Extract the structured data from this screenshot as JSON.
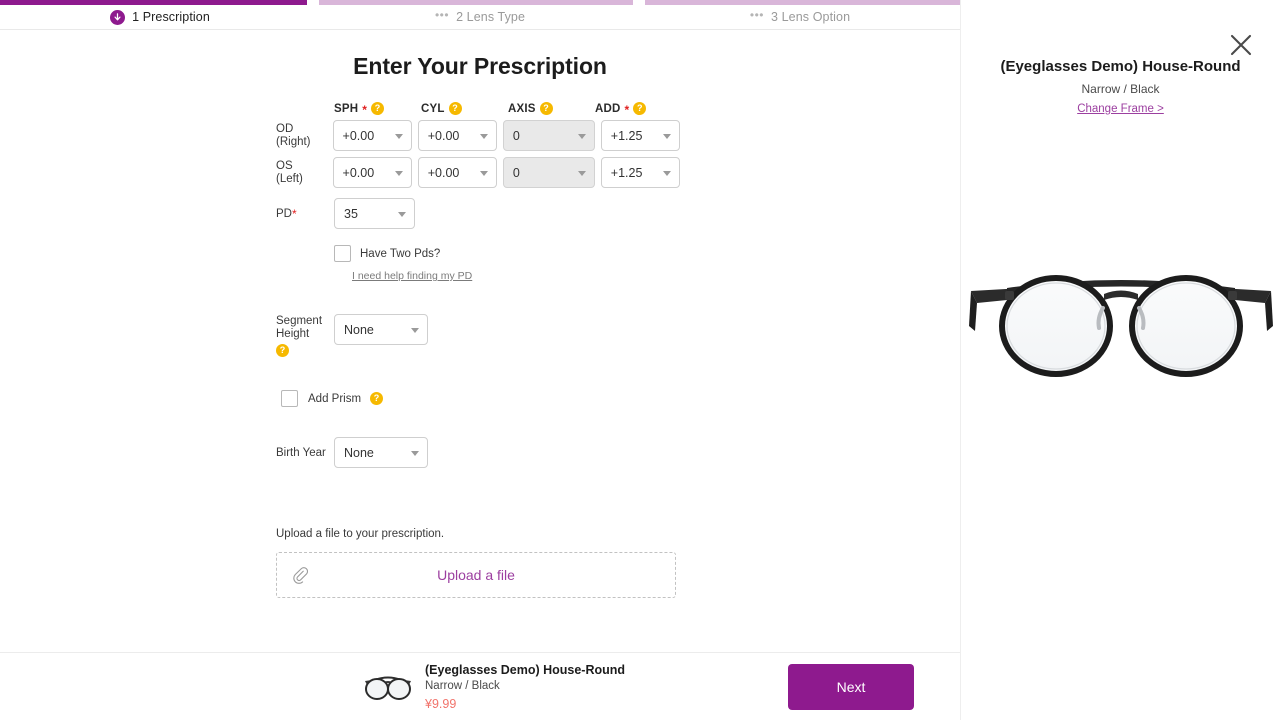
{
  "steps": [
    {
      "label": "1 Prescription",
      "state": "current",
      "icon": "arrow-down-circle-icon",
      "bar": "active"
    },
    {
      "label": "2 Lens Type",
      "state": "upcoming",
      "icon": "ellipsis-icon",
      "bar": "inactive"
    },
    {
      "label": "3 Lens Option",
      "state": "upcoming",
      "icon": "ellipsis-icon",
      "bar": "inactive"
    }
  ],
  "nav": {
    "back_icon": "arrow-left-icon"
  },
  "main": {
    "title": "Enter Your Prescription",
    "columns": [
      {
        "label": "SPH",
        "required": true,
        "help": "?"
      },
      {
        "label": "CYL",
        "required": false,
        "help": "?"
      },
      {
        "label": "AXIS",
        "required": false,
        "help": "?"
      },
      {
        "label": "ADD",
        "required": true,
        "help": "?"
      }
    ],
    "rows": [
      {
        "label_line1": "OD",
        "label_line2": "(Right)",
        "fields": [
          {
            "name": "sph",
            "value": "+0.00",
            "disabled": false
          },
          {
            "name": "cyl",
            "value": "+0.00",
            "disabled": false
          },
          {
            "name": "axis",
            "value": "0",
            "disabled": true
          },
          {
            "name": "add",
            "value": "+1.25",
            "disabled": false
          }
        ]
      },
      {
        "label_line1": "OS",
        "label_line2": "(Left)",
        "fields": [
          {
            "name": "sph",
            "value": "+0.00",
            "disabled": false
          },
          {
            "name": "cyl",
            "value": "+0.00",
            "disabled": false
          },
          {
            "name": "axis",
            "value": "0",
            "disabled": true
          },
          {
            "name": "add",
            "value": "+1.25",
            "disabled": false
          }
        ]
      }
    ],
    "pd": {
      "label": "PD",
      "required": true,
      "value": "35"
    },
    "two_pds": {
      "label": "Have Two Pds?",
      "checked": false
    },
    "pd_help_link": "I need help finding my PD",
    "segment_height": {
      "label_line1": "Segment",
      "label_line2": "Height",
      "value": "None",
      "help": "?"
    },
    "add_prism": {
      "label": "Add Prism",
      "checked": false,
      "help": "?"
    },
    "birth_year": {
      "label": "Birth Year",
      "value": "None"
    },
    "upload": {
      "caption": "Upload a file to your prescription.",
      "button_label": "Upload a file",
      "icon": "paperclip-icon"
    }
  },
  "right_panel": {
    "close_icon": "close-icon",
    "product_title": "(Eyeglasses Demo) House-Round",
    "product_variant": "Narrow / Black",
    "change_frame_label": "Change Frame >",
    "product_image_alt": "black-round-eyeglasses-image"
  },
  "bottom_bar": {
    "thumbnail_alt": "eyeglasses-thumbnail",
    "product_title": "(Eyeglasses Demo) House-Round",
    "product_variant": "Narrow / Black",
    "price": "¥9.99",
    "next_label": "Next"
  },
  "colors": {
    "brand_purple": "#8e1a8e",
    "link_purple": "#9c3fa0",
    "progress_inactive": "#d9b6d9",
    "help_yellow": "#f6b900",
    "price_red": "#f1736b",
    "required_red": "#e02020",
    "disabled_gray": "#e9e9e9"
  }
}
